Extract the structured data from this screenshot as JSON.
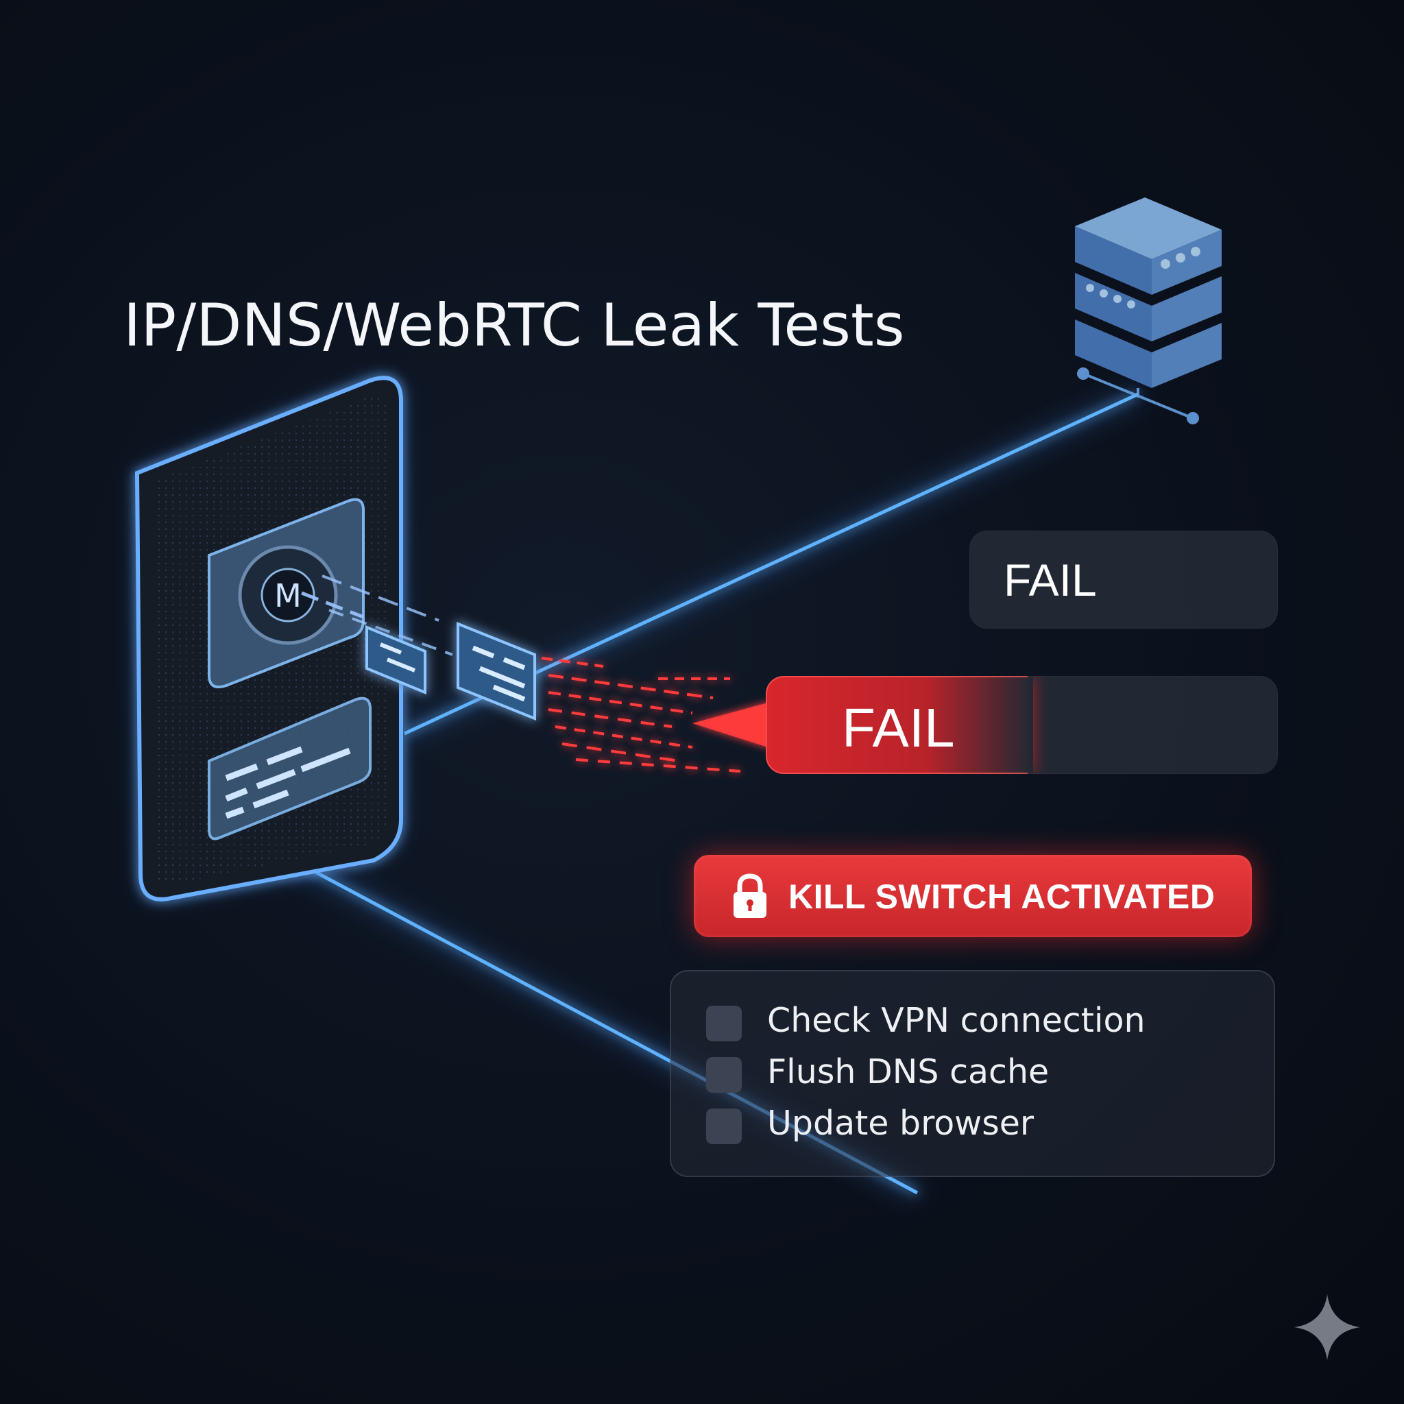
{
  "headline": "IP/DNS/WebRTC Leak Tests",
  "device": {
    "app_badge_letter": "M"
  },
  "results": [
    {
      "label": "FAIL"
    },
    {
      "label": "FAIL"
    }
  ],
  "alert": {
    "label": "KILL SWITCH ACTIVATED",
    "icon": "lock-icon",
    "color": "#e0302f"
  },
  "checklist": [
    {
      "label": "Check VPN connection",
      "checked": false
    },
    {
      "label": "Flush DNS cache",
      "checked": false
    },
    {
      "label": "Update browser",
      "checked": false
    }
  ],
  "colors": {
    "background": "#0a0f19",
    "beam_blue": "#4ea6ff",
    "leak_red": "#e8343a"
  },
  "watermark_icon": "sparkle-icon"
}
